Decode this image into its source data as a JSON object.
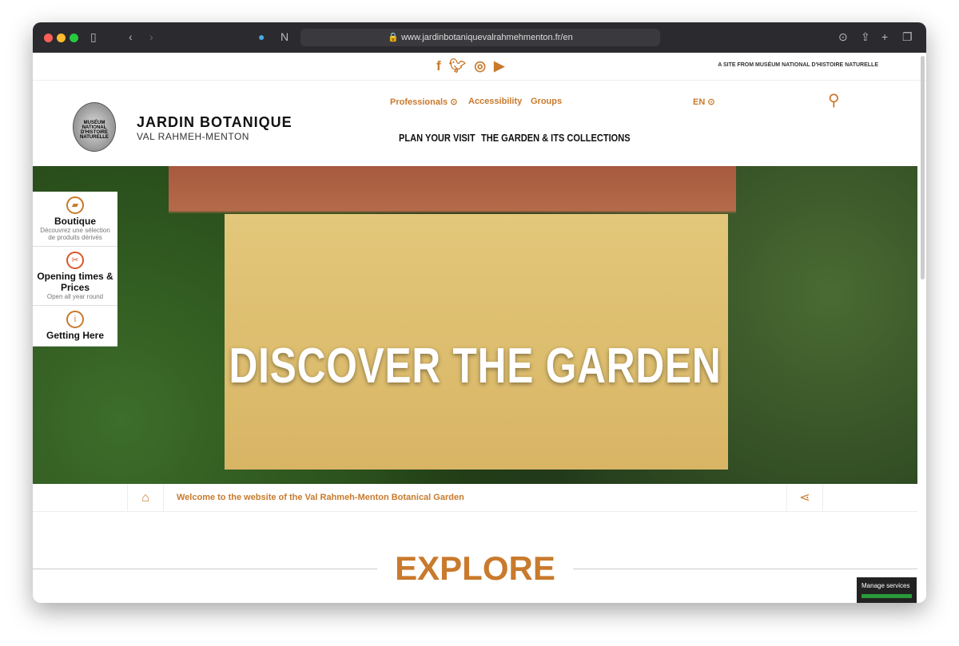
{
  "browser": {
    "url": "www.jardinbotaniquevalrahmehmenton.fr/en"
  },
  "topbar": {
    "social": [
      "facebook-icon",
      "twitter-icon",
      "instagram-icon",
      "youtube-icon"
    ],
    "museum_link": "A SITE FROM MUSÉUM NATIONAL D'HISTOIRE NATURELLE"
  },
  "header": {
    "logo_text": "MUSÉUM NATIONAL D'HISTOIRE NATURELLE",
    "brand": "JARDIN BOTANIQUE",
    "brand_sub": "VAL RAHMEH-MENTON",
    "sub_nav": [
      "Professionals",
      "Accessibility",
      "Groups"
    ],
    "lang": "EN",
    "main_nav": [
      "PLAN YOUR VISIT",
      "THE GARDEN & ITS COLLECTIONS"
    ]
  },
  "hero": {
    "title": "DISCOVER THE GARDEN"
  },
  "side": [
    {
      "title": "Boutique",
      "desc": "Découvrez une sélection de produits dérivés"
    },
    {
      "title": "Opening times & Prices",
      "desc": "Open all year round"
    },
    {
      "title": "Getting Here",
      "desc": ""
    }
  ],
  "breadcrumb": {
    "text": "Welcome to the website of the Val Rahmeh-Menton Botanical Garden"
  },
  "section": {
    "title": "EXPLORE"
  },
  "cookies": {
    "label": "Manage services"
  },
  "colors": {
    "accent": "#c97a2c"
  }
}
